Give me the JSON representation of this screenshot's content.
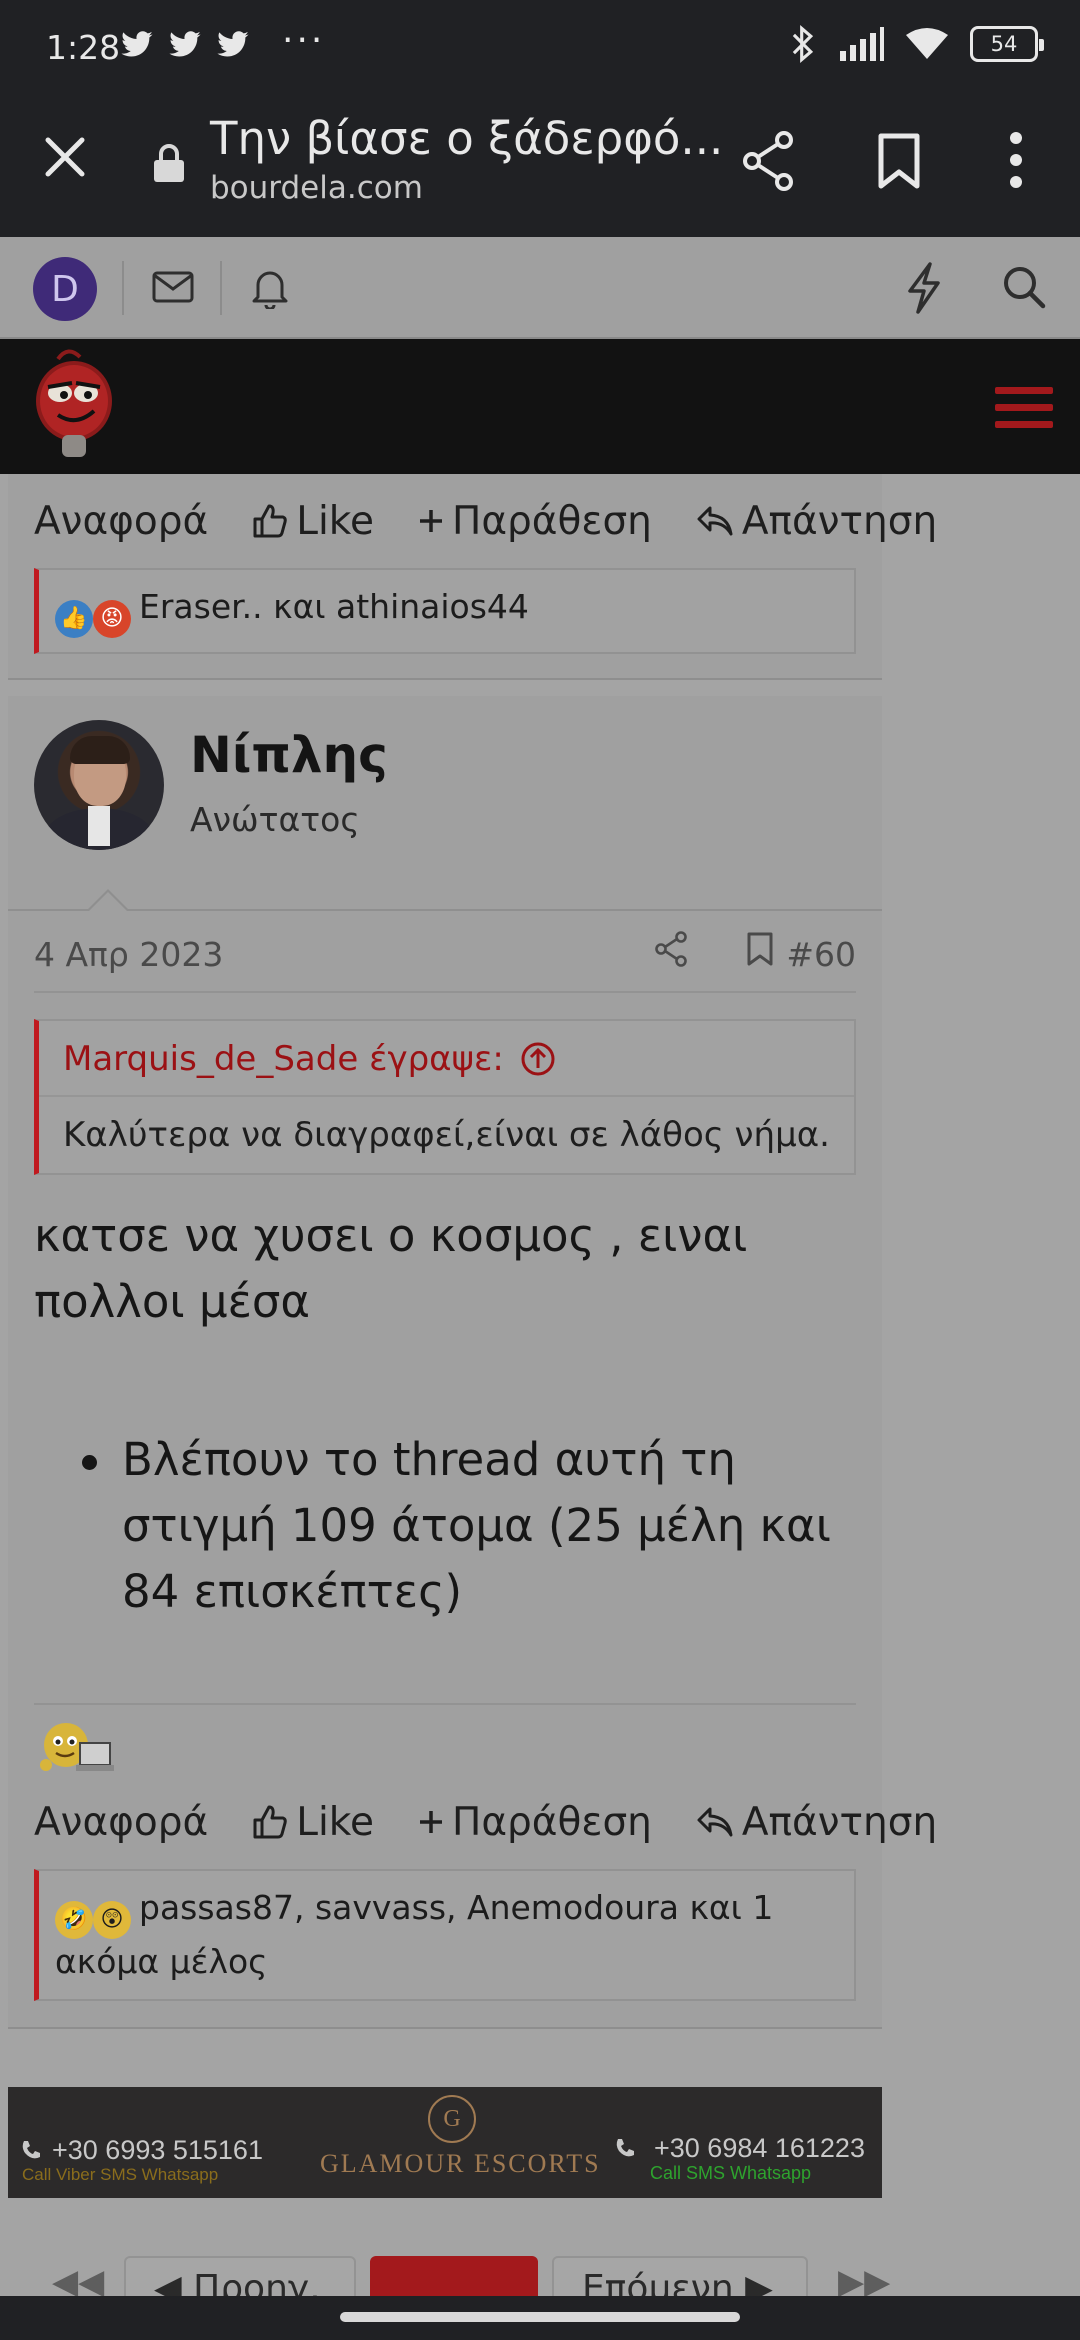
{
  "status_bar": {
    "time": "1:28",
    "notification_icons": [
      "twitter-icon",
      "twitter-icon",
      "twitter-icon"
    ],
    "more": "···",
    "battery": "54"
  },
  "browser": {
    "title": "Την βίασε ο ξάδερφό...",
    "domain": "bourdela.com"
  },
  "site_toolbar": {
    "avatar_letter": "D"
  },
  "prev_post": {
    "actions": {
      "report": "Αναφορά",
      "like": "Like",
      "quote": "Παράθεση",
      "reply": "Απάντηση"
    },
    "reactions_text": "Eraser.. και athinaios44"
  },
  "post": {
    "username": "Νίπλης",
    "role": "Ανώτατος",
    "date": "4 Απρ 2023",
    "number": "#60",
    "quote": {
      "author": "Marquis_de_Sade έγραψε:",
      "text": "Καλύτερα να διαγραφεί,είναι σε λάθος νήμα."
    },
    "text": "κατσε να χυσει ο κοσμος , ειναι πολλοι μέσα",
    "list_item": "Βλέπουν το thread αυτή τη στιγμή 109 άτομα (25 μέλη και 84 επισκέπτες)",
    "actions": {
      "report": "Αναφορά",
      "like": "Like",
      "quote": "Παράθεση",
      "reply": "Απάντηση"
    },
    "reactions_text": "passas87, savvass, Anemodoura και 1 ακόμα μέλος"
  },
  "ad": {
    "phone_left": "+30 6993 515161",
    "sub_left": "Call Viber SMS Whatsapp",
    "brand": "GLAMOUR ESCORTS",
    "brand_letter": "G",
    "phone_right": "+30 6984 161223",
    "sub_right": "Call SMS Whatsapp"
  },
  "pagination": {
    "first": "◀◀",
    "prev": "◀ Προηγ.",
    "next": "Επόμενη ▶",
    "last": "▶▶"
  },
  "colors": {
    "accent": "#c0191f",
    "header_bg": "#121212",
    "chrome_bg": "#202124"
  }
}
